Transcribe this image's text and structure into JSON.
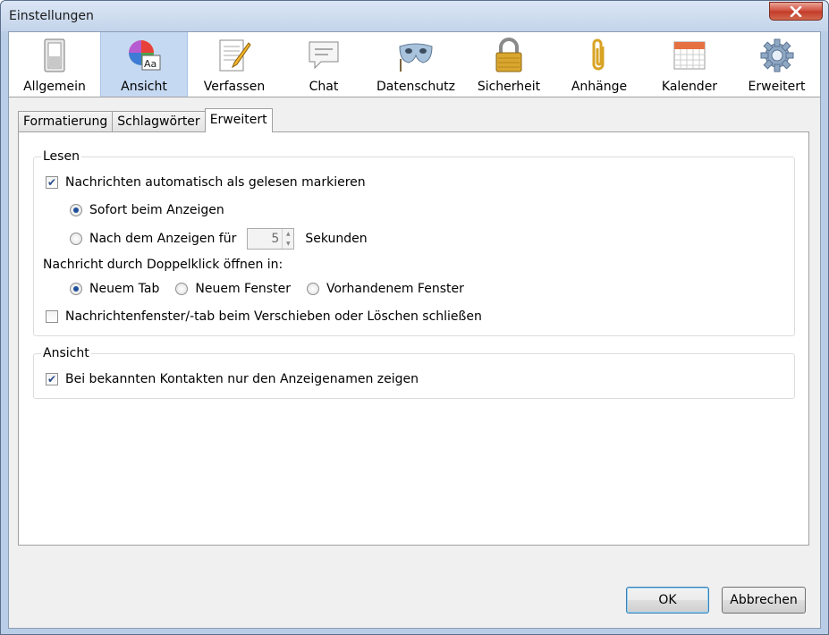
{
  "window": {
    "title": "Einstellungen"
  },
  "toolbar": {
    "items": [
      {
        "label": "Allgemein",
        "icon": "switch-icon"
      },
      {
        "label": "Ansicht",
        "icon": "color-wheel-font-icon",
        "active": true
      },
      {
        "label": "Verfassen",
        "icon": "notepad-pencil-icon"
      },
      {
        "label": "Chat",
        "icon": "chat-bubble-icon"
      },
      {
        "label": "Datenschutz",
        "icon": "mask-icon"
      },
      {
        "label": "Sicherheit",
        "icon": "padlock-icon"
      },
      {
        "label": "Anhänge",
        "icon": "paperclip-icon"
      },
      {
        "label": "Kalender",
        "icon": "calendar-icon"
      },
      {
        "label": "Erweitert",
        "icon": "gear-icon"
      }
    ]
  },
  "tabs": [
    "Formatierung",
    "Schlagwörter",
    "Erweitert"
  ],
  "lesen": {
    "label": "Lesen",
    "auto_mark": "Nachrichten automatisch als gelesen markieren",
    "immediately": "Sofort beim Anzeigen",
    "after_prefix": "Nach dem Anzeigen für",
    "seconds_value": "5",
    "seconds_suffix": "Sekunden",
    "doubleclick_label": "Nachricht durch Doppelklick öffnen in:",
    "new_tab": "Neuem Tab",
    "new_window": "Neuem Fenster",
    "existing_window": "Vorhandenem Fenster",
    "close_on_move": "Nachrichtenfenster/-tab beim Verschieben oder Löschen schließen"
  },
  "ansicht": {
    "label": "Ansicht",
    "display_names": "Bei bekannten Kontakten nur den Anzeigenamen zeigen"
  },
  "buttons": {
    "ok": "OK",
    "cancel": "Abbrechen"
  },
  "colors": {
    "active_tab_bg": "#c6d9f2",
    "close_red": "#c23a28"
  }
}
